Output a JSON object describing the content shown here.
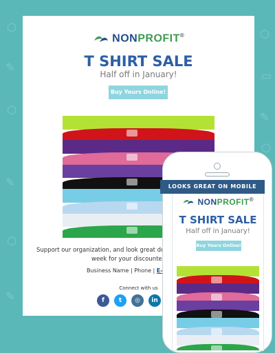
{
  "brand": {
    "name_part1": "NON",
    "name_part2": "PROFIT",
    "registered": "®"
  },
  "email": {
    "title": "T SHIRT SALE",
    "subtitle": "Half off in January!",
    "cta_label": "Buy Yours Online!",
    "body_line1": "Support our organization, and look great doing it! Orde",
    "body_line2": "week for your discounte",
    "footer_business": "Business Name",
    "footer_sep": "|",
    "footer_phone": "Phone",
    "footer_email": "E-mail",
    "connect_label": "Connect with us",
    "social": [
      {
        "icon": "facebook-icon",
        "glyph": "f",
        "color": "#3b5998"
      },
      {
        "icon": "twitter-icon",
        "glyph": "t",
        "color": "#1da1f2"
      },
      {
        "icon": "instagram-icon",
        "glyph": "◎",
        "color": "#3f729b"
      },
      {
        "icon": "linkedin-icon",
        "glyph": "in",
        "color": "#0e76a8"
      }
    ]
  },
  "mobile": {
    "ribbon_label": "LOOKS GREAT ON MOBILE",
    "title": "T SHIRT SALE",
    "subtitle": "Half off in January!",
    "cta_label": "Buy Yours Online!"
  },
  "colors": {
    "background": "#5ab8b9",
    "title_blue": "#2d5fa6",
    "cta": "#8fd5df",
    "ribbon": "#2f5a86"
  },
  "shirt_colors": [
    "#b4e234",
    "#d0141a",
    "#5b2a86",
    "#e06a9a",
    "#6a3fa0",
    "#111111",
    "#78cde6",
    "#b8d8f0",
    "#e8eef4",
    "#2ca64a"
  ]
}
